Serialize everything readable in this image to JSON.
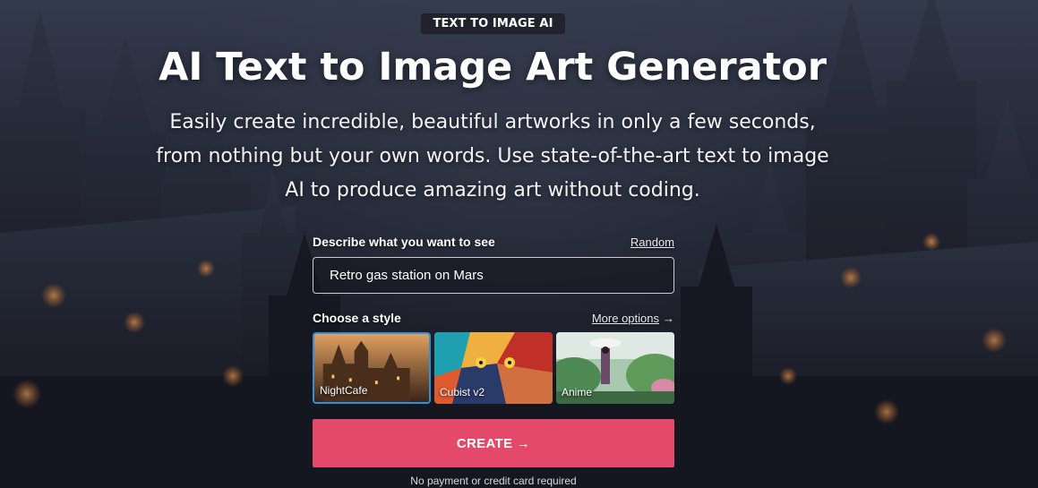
{
  "hero": {
    "badge": "TEXT TO IMAGE AI",
    "title": "AI Text to Image Art Generator",
    "subtitle": "Easily create incredible, beautiful artworks in only a few seconds, from nothing but your own words. Use state-of-the-art text to image AI to produce amazing art without coding."
  },
  "form": {
    "prompt_label": "Describe what you want to see",
    "random_link": "Random",
    "prompt_value": "Retro gas station on Mars",
    "style_label": "Choose a style",
    "more_options_link": "More options",
    "more_options_icon": "arrow-right-icon",
    "styles": [
      {
        "name": "NightCafe",
        "selected": true
      },
      {
        "name": "Cubist v2",
        "selected": false
      },
      {
        "name": "Anime",
        "selected": false
      }
    ],
    "create_label": "CREATE",
    "create_icon": "arrow-right-icon",
    "note": "No payment or credit card required"
  },
  "colors": {
    "accent": "#e5496a",
    "selected_border": "#2f8fd8"
  }
}
